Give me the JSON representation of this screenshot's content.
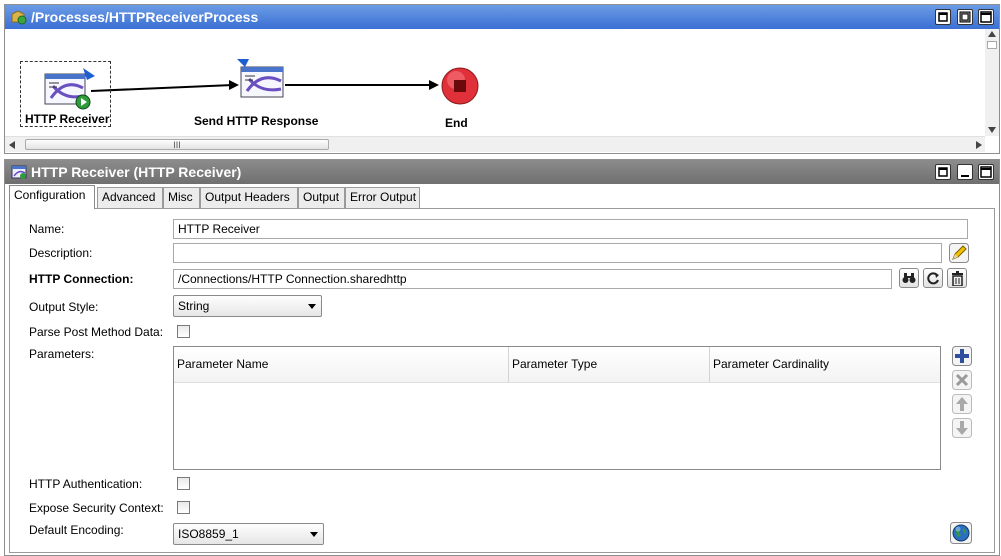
{
  "process": {
    "title": "/Processes/HTTPReceiverProcess",
    "activities": [
      {
        "label": "HTTP Receiver"
      },
      {
        "label": "Send HTTP Response"
      },
      {
        "label": "End"
      }
    ],
    "hscroll_grip": "III"
  },
  "properties": {
    "title": "HTTP Receiver (HTTP Receiver)",
    "tabs": [
      "Configuration",
      "Advanced",
      "Misc",
      "Output Headers",
      "Output",
      "Error Output"
    ],
    "active_tab": "Configuration",
    "fields": {
      "name_label": "Name:",
      "name_value": "HTTP Receiver",
      "description_label": "Description:",
      "description_value": "",
      "connection_label": "HTTP Connection:",
      "connection_value": "/Connections/HTTP Connection.sharedhttp",
      "output_style_label": "Output Style:",
      "output_style_value": "String",
      "parse_post_label": "Parse Post Method Data:",
      "parameters_label": "Parameters:",
      "http_auth_label": "HTTP Authentication:",
      "expose_security_label": "Expose Security Context:",
      "default_encoding_label": "Default Encoding:",
      "default_encoding_value": "ISO8859_1"
    },
    "parameters_table": {
      "columns": [
        "Parameter Name",
        "Parameter Type",
        "Parameter Cardinality"
      ],
      "rows": []
    }
  },
  "colors": {
    "process_title_bg": "#3b6fd3",
    "props_title_bg": "#6f6f6f",
    "end_node": "#e0303a"
  }
}
